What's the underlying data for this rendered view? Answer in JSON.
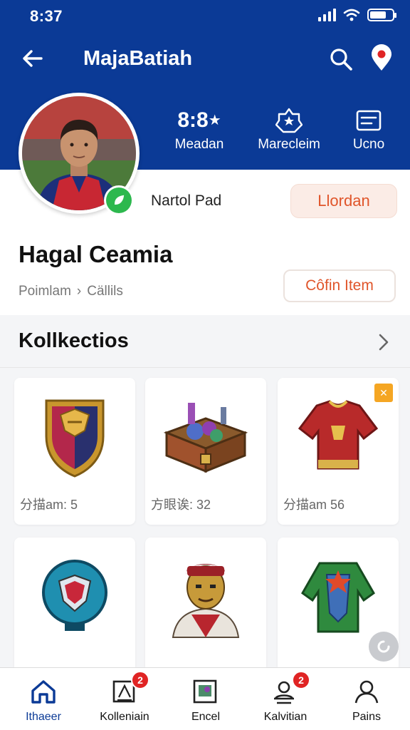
{
  "status_bar": {
    "time": "8:37"
  },
  "app_bar": {
    "title": "MajaBatiah"
  },
  "stats": [
    {
      "value": "8:8",
      "label": "Meadan"
    },
    {
      "label": "Marecleim"
    },
    {
      "label": "Ucno"
    }
  ],
  "profile": {
    "handle": "Nartol Pad",
    "follow_label": "Llordan",
    "name": "Hagal Ceamia",
    "breadcrumb": [
      "Poimlam",
      "Cällils"
    ],
    "edit_label": "Côfin Item"
  },
  "collection": {
    "title": "Kollkectios",
    "items": [
      {
        "count": "分描am: 5",
        "icon": "crest-shield-icon"
      },
      {
        "count": "方眼诶: 32",
        "icon": "treasure-chest-icon"
      },
      {
        "count": "分描am 56",
        "icon": "red-jersey-icon",
        "badge": "✕"
      },
      {
        "icon": "blue-emblem-icon"
      },
      {
        "icon": "warrior-bust-icon"
      },
      {
        "icon": "green-armor-icon"
      }
    ]
  },
  "bottom_nav": [
    {
      "label": "Ithaeer",
      "icon": "home-icon",
      "active": true
    },
    {
      "label": "Kolleniain",
      "icon": "collection-icon",
      "badge": "2"
    },
    {
      "label": "Encel",
      "icon": "gallery-icon"
    },
    {
      "label": "Kalvitian",
      "icon": "inbox-icon",
      "badge": "2"
    },
    {
      "label": "Pains",
      "icon": "profile-icon"
    }
  ],
  "colors": {
    "header": "#0b3a96",
    "accent": "#e0552a",
    "online": "#2db84e",
    "badge": "#e02424"
  }
}
